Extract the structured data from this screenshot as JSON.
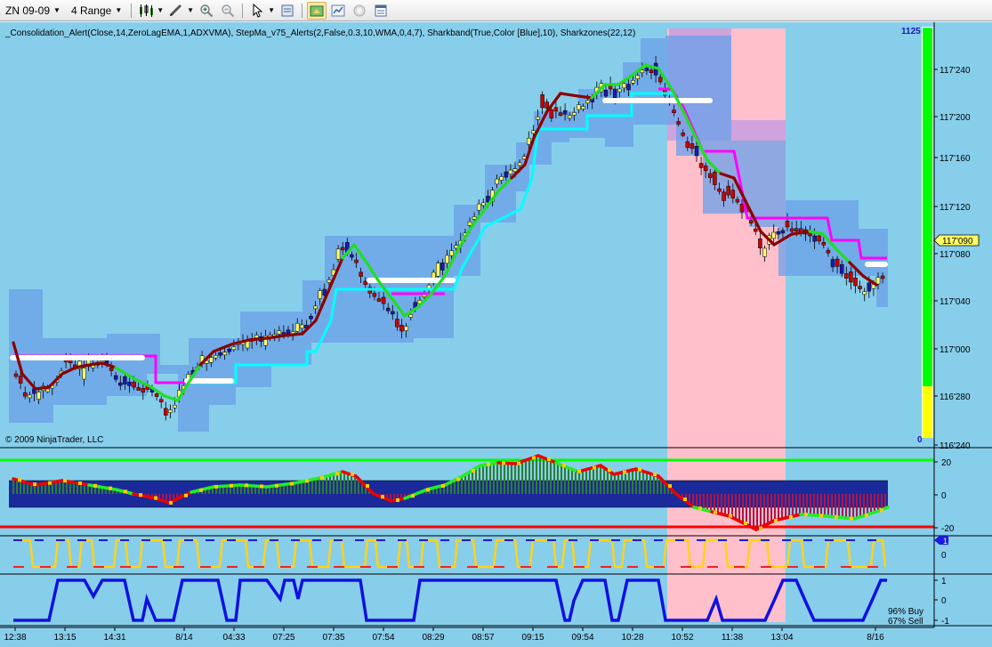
{
  "toolbar": {
    "instrument": "ZN 09-09",
    "period": "4 Range",
    "icons": [
      "bar-type-icon",
      "draw-pen-icon",
      "zoom-in-icon",
      "zoom-out-icon",
      "pointer-icon",
      "data-box-icon",
      "properties-icon",
      "strategies-icon",
      "chart-trader-icon",
      "indicators-list-icon"
    ]
  },
  "chart": {
    "indicator_label": "_Consolidation_Alert(Close,14,ZeroLagEMA,1,ADXVMA), StepMa_v75_Alerts(2,False,0.3,10,WMA,0,4,7), Sharkband(True,Color [Blue],10), Sharkzones(22,12)",
    "copyright": "© 2009 NinjaTrader, LLC",
    "gauge_top": "1125",
    "gauge_bottom": "0",
    "current_price": "117'090",
    "buy_label": "96% Buy",
    "sell_label": "67% Sell",
    "colors": {
      "background": "#87ceeb",
      "band": "#6aa0e8",
      "zone_pink": "#ffc0cb",
      "zone_purple": "#c89ee0",
      "bull_candle": "#ffff66",
      "bear_candle": "#cc0000",
      "dark_candle": "#1a1ab0",
      "gauge_green": "#00ff00",
      "gauge_yellow": "#ffff00"
    }
  },
  "chart_data": {
    "type": "line",
    "x_tick_labels": [
      "12:38",
      "13:15",
      "14:31",
      "8/14",
      "04:33",
      "07:25",
      "07:35",
      "07:54",
      "08:29",
      "08:57",
      "09:15",
      "09:54",
      "10:28",
      "10:52",
      "11:38",
      "13:04",
      "8/16"
    ],
    "price_axis": {
      "tick_labels": [
        "117'240",
        "117'200",
        "117'160",
        "117'120",
        "117'080",
        "117'040",
        "117'000",
        "116'280",
        "116'240"
      ],
      "current": "117'090"
    },
    "oscillator_axis": {
      "tick_labels": [
        "20",
        "0",
        "-20"
      ]
    },
    "panel3_axis": {
      "tick_labels": [
        "1",
        "0"
      ]
    },
    "panel4_axis": {
      "tick_labels": [
        "1",
        "0",
        "-1"
      ]
    }
  }
}
